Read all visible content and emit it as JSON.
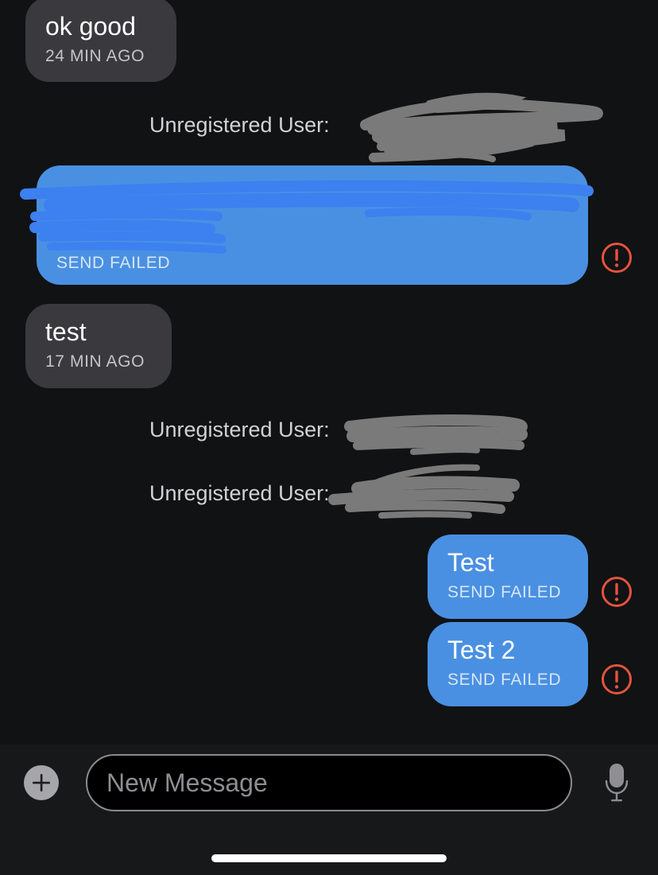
{
  "conversation": {
    "messages": [
      {
        "direction": "incoming",
        "text": "ok good",
        "meta": "24 MIN AGO"
      },
      {
        "direction": "outgoing",
        "text": "",
        "meta": "SEND FAILED"
      },
      {
        "direction": "incoming",
        "text": "test",
        "meta": "17 MIN AGO"
      },
      {
        "direction": "outgoing",
        "text": "Test",
        "meta": "SEND FAILED"
      },
      {
        "direction": "outgoing",
        "text": "Test 2",
        "meta": "SEND FAILED"
      }
    ],
    "notices": [
      {
        "label": "Unregistered User:"
      },
      {
        "label": "Unregistered User:"
      },
      {
        "label": "Unregistered User:"
      }
    ],
    "failed_icon": "exclamation-circle-icon"
  },
  "composer": {
    "placeholder": "New Message",
    "value": "",
    "add_icon": "plus-circle-icon",
    "mic_icon": "microphone-icon"
  },
  "colors": {
    "background": "#111214",
    "incoming_bubble": "#3a3a3e",
    "outgoing_bubble": "#4a90e2",
    "error": "#e5533d",
    "redaction_gray": "#7a7a7a",
    "redaction_blue": "#3d80f0"
  }
}
